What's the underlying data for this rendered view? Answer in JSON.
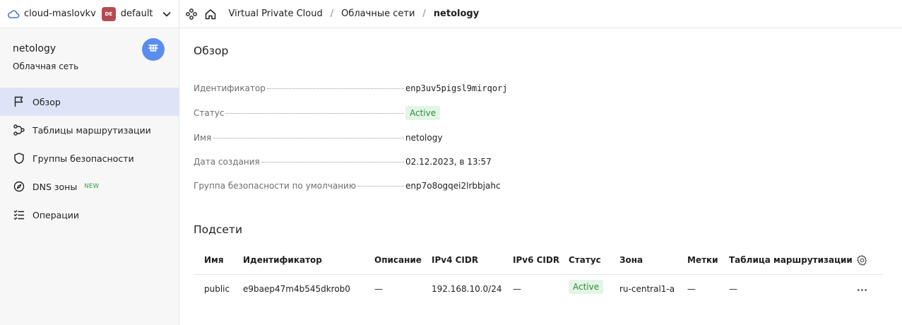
{
  "topbar": {
    "cloud_name": "cloud-maslovkv",
    "folder_badge": "DE",
    "folder_name": "default",
    "breadcrumbs": [
      "Virtual Private Cloud",
      "Облачные сети",
      "netology"
    ],
    "separator": "/"
  },
  "sidebar": {
    "title": "netology",
    "subtitle": "Облачная сеть",
    "items": [
      {
        "label": "Обзор",
        "icon": "flag-icon",
        "active": true
      },
      {
        "label": "Таблицы маршрутизации",
        "icon": "route-icon"
      },
      {
        "label": "Группы безопасности",
        "icon": "shield-icon"
      },
      {
        "label": "DNS зоны",
        "icon": "compass-icon",
        "badge": "NEW"
      },
      {
        "label": "Операции",
        "icon": "list-icon"
      }
    ]
  },
  "overview": {
    "title": "Обзор",
    "props": [
      {
        "key": "Идентификатор",
        "value": "enp3uv5pigsl9mirqorj"
      },
      {
        "key": "Статус",
        "value": "Active"
      },
      {
        "key": "Имя",
        "value": "netology"
      },
      {
        "key": "Дата создания",
        "value": "02.12.2023, в 13:57"
      },
      {
        "key": "Группа безопасности по умолчанию",
        "value": "enp7o8ogqei2lrbbjahc"
      }
    ]
  },
  "subnets": {
    "title": "Подсети",
    "columns": [
      "Имя",
      "Идентификатор",
      "Описание",
      "IPv4 CIDR",
      "IPv6 CIDR",
      "Статус",
      "Зона",
      "Метки",
      "Таблица маршрутизации"
    ],
    "rows": [
      [
        "public",
        "e9baep47m4b545dkrob0",
        "—",
        "192.168.10.0/24",
        "—",
        "Active",
        "ru-central1-a",
        "—",
        "—"
      ]
    ]
  },
  "colors": {
    "accent": "#5b8def",
    "folder_badge": "#b54b52",
    "status_bg": "#e3f5e6",
    "status_text": "#2f8a3a",
    "active_nav": "#dde4f7"
  }
}
